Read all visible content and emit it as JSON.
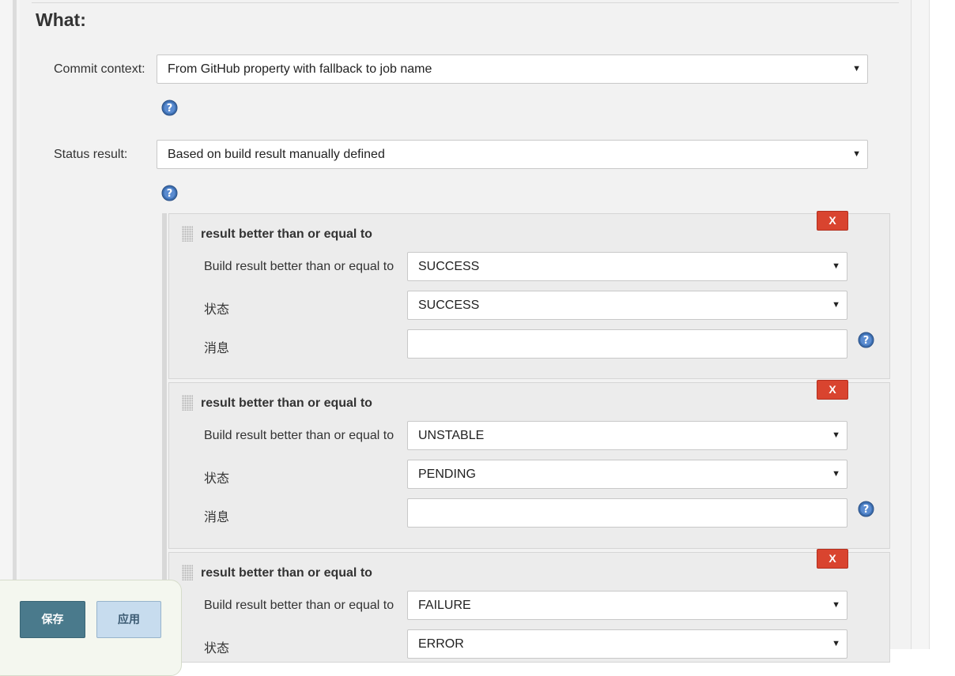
{
  "section": {
    "title": "What:"
  },
  "commit_context": {
    "label": "Commit context:",
    "value": "From GitHub property with fallback to job name"
  },
  "status_result": {
    "label": "Status result:",
    "value": "Based on build result manually defined"
  },
  "rules": [
    {
      "title": "result better than or equal to",
      "remove_label": "X",
      "build_result_label": "Build result better than or equal to",
      "build_result_value": "SUCCESS",
      "state_label": "状态",
      "state_value": "SUCCESS",
      "message_label": "消息",
      "message_value": ""
    },
    {
      "title": "result better than or equal to",
      "remove_label": "X",
      "build_result_label": "Build result better than or equal to",
      "build_result_value": "UNSTABLE",
      "state_label": "状态",
      "state_value": "PENDING",
      "message_label": "消息",
      "message_value": ""
    },
    {
      "title": "result better than or equal to",
      "remove_label": "X",
      "build_result_label": "Build result better than or equal to",
      "build_result_value": "FAILURE",
      "state_label": "状态",
      "state_value": "ERROR"
    }
  ],
  "icons": {
    "help": "help-icon",
    "dropdown": "chevron-down-icon",
    "drag": "drag-handle-icon"
  },
  "colors": {
    "remove_button": "#d9442f",
    "save_button": "#4a7a8c",
    "apply_button": "#c7dcee",
    "help_icon": "#3d6fb0"
  },
  "footer": {
    "save_label": "保存",
    "apply_label": "应用"
  }
}
